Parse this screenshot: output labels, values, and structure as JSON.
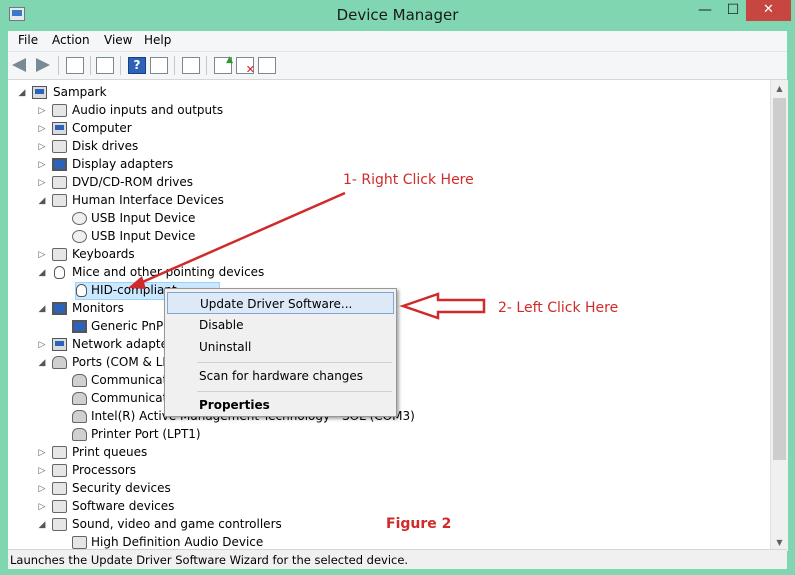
{
  "window": {
    "title": "Device Manager",
    "controls": {
      "minimize": "—",
      "maximize": "☐",
      "close": "✕"
    }
  },
  "menubar": {
    "items": [
      "File",
      "Action",
      "View",
      "Help"
    ]
  },
  "toolbar": {
    "icons": [
      "back-icon",
      "forward-icon",
      "show-hide-tree-icon",
      "properties-icon",
      "help-icon",
      "view-icon",
      "scan-hardware-icon",
      "update-driver-icon",
      "uninstall-icon",
      "disable-icon"
    ]
  },
  "tree": {
    "root": "Sampark",
    "rows": [
      {
        "label": "Audio inputs and outputs",
        "expander": "▷"
      },
      {
        "label": "Computer",
        "expander": "▷"
      },
      {
        "label": "Disk drives",
        "expander": "▷"
      },
      {
        "label": "Display adapters",
        "expander": "▷"
      },
      {
        "label": "DVD/CD-ROM drives",
        "expander": "▷"
      },
      {
        "label": "Human Interface Devices",
        "expander": "◢"
      },
      {
        "label": "USB Input Device",
        "expander": ""
      },
      {
        "label": "USB Input Device",
        "expander": ""
      },
      {
        "label": "Keyboards",
        "expander": "▷"
      },
      {
        "label": "Mice and other pointing devices",
        "expander": "◢"
      },
      {
        "label": "HID-compliant",
        "expander": ""
      },
      {
        "label": "Monitors",
        "expander": "◢"
      },
      {
        "label": "Generic PnP M",
        "expander": ""
      },
      {
        "label": "Network adapters",
        "expander": "▷"
      },
      {
        "label": "Ports (COM & LPT",
        "expander": "◢"
      },
      {
        "label": "Communicati",
        "expander": ""
      },
      {
        "label": "Communicati",
        "expander": ""
      },
      {
        "label": "Intel(R) Active Management Technology - SOL (COM3)",
        "expander": ""
      },
      {
        "label": "Printer Port (LPT1)",
        "expander": ""
      },
      {
        "label": "Print queues",
        "expander": "▷"
      },
      {
        "label": "Processors",
        "expander": "▷"
      },
      {
        "label": "Security devices",
        "expander": "▷"
      },
      {
        "label": "Software devices",
        "expander": "▷"
      },
      {
        "label": "Sound, video and game controllers",
        "expander": "◢"
      },
      {
        "label": "High Definition Audio Device",
        "expander": ""
      }
    ]
  },
  "context_menu": {
    "update_driver": "Update Driver Software...",
    "disable": "Disable",
    "uninstall": "Uninstall",
    "scan": "Scan for hardware changes",
    "properties": "Properties"
  },
  "status": {
    "text": "Launches the Update Driver Software Wizard for the selected device."
  },
  "annotations": {
    "step1": "1- Right Click Here",
    "step2": "2- Left Click Here",
    "figure": "Figure 2",
    "color": "#d02a2a"
  },
  "colors": {
    "frame": "#7fd6b0",
    "close_button": "#c7463f",
    "selection": "#cce8ff"
  }
}
